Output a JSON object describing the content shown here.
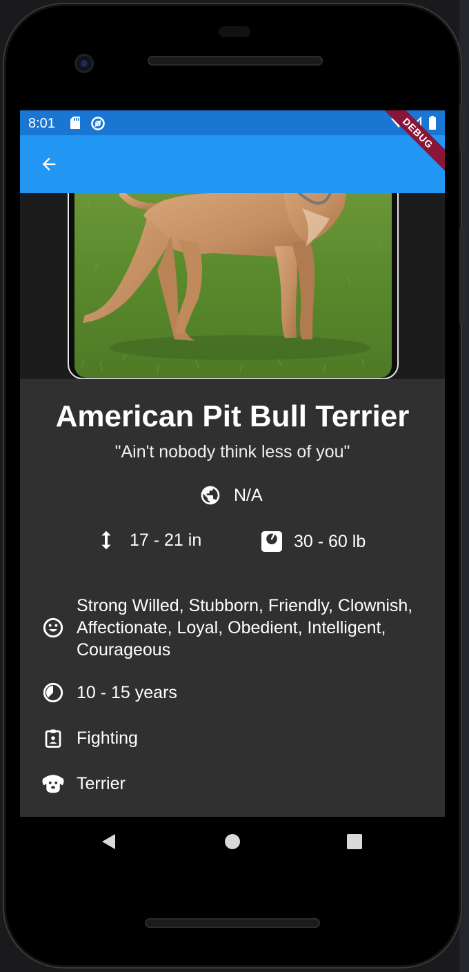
{
  "status_bar": {
    "time": "8:01",
    "icons": [
      "sd-card-icon",
      "sync-icon",
      "wifi-icon",
      "signal-icon",
      "battery-icon"
    ]
  },
  "app_bar": {
    "back_icon": "arrow-back-icon",
    "color": "#2196f3",
    "status_color": "#1976d2"
  },
  "debug_banner": {
    "label": "DEBUG"
  },
  "breed": {
    "name": "American Pit Bull Terrier",
    "slogan": "\"Ain't nobody think less of you\"",
    "origin": "N/A",
    "height": "17 - 21 in",
    "weight": "30 - 60 lb",
    "temperament": "Strong Willed, Stubborn, Friendly, Clownish, Affectionate, Loyal, Obedient, Intelligent, Courageous",
    "life_span": "10 - 15 years",
    "bred_for": "Fighting",
    "group": "Terrier"
  },
  "icons": {
    "origin": "globe-icon",
    "height": "vertical-arrows-icon",
    "weight": "scale-icon",
    "temperament": "smiley-icon",
    "life_span": "clock-icon",
    "bred_for": "clipboard-icon",
    "group": "dog-icon"
  },
  "nav_bar": {
    "buttons": [
      "back-triangle-icon",
      "home-circle-icon",
      "recents-square-icon"
    ]
  }
}
